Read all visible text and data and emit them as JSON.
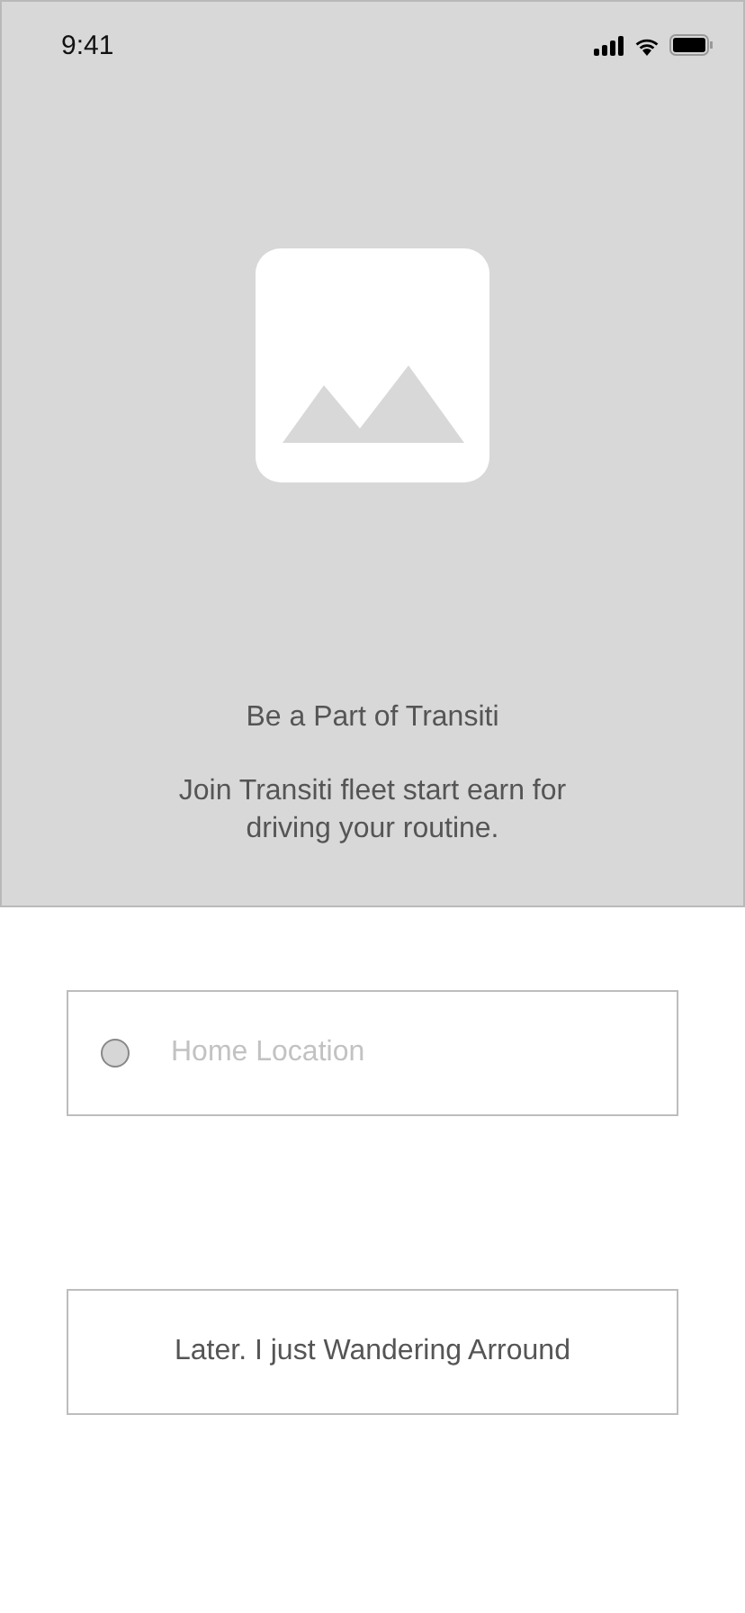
{
  "status_bar": {
    "time": "9:41"
  },
  "hero": {
    "title": "Be a Part of Transiti",
    "subtitle": "Join Transiti fleet start earn for driving your routine."
  },
  "location_field": {
    "placeholder": "Home Location"
  },
  "later_button": {
    "label": "Later. I just Wandering Arround"
  }
}
